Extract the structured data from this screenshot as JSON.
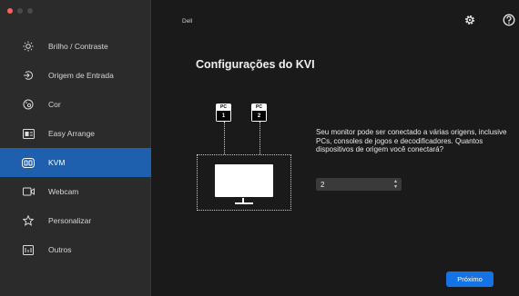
{
  "window": {
    "title": "Dell",
    "traffic_colors": [
      "#ff5f57",
      "#4a4a4a",
      "#4a4a4a"
    ]
  },
  "toolbar": {
    "settings_icon": "gear-icon",
    "help_icon": "help-icon"
  },
  "sidebar": {
    "items": [
      {
        "label": "Brilho / Contraste",
        "icon": "brightness-icon",
        "active": false
      },
      {
        "label": "Origem de Entrada",
        "icon": "input-source-icon",
        "active": false
      },
      {
        "label": "Cor",
        "icon": "color-icon",
        "active": false
      },
      {
        "label": "Easy Arrange",
        "icon": "easy-arrange-icon",
        "active": false
      },
      {
        "label": "KVM",
        "icon": "kvm-icon",
        "active": true
      },
      {
        "label": "Webcam",
        "icon": "webcam-icon",
        "active": false
      },
      {
        "label": "Personalizar",
        "icon": "star-icon",
        "active": false
      },
      {
        "label": "Outros",
        "icon": "other-icon",
        "active": false
      }
    ],
    "active_color": "#1e5fae"
  },
  "main": {
    "title": "Configurações do KVI",
    "diagram": {
      "pcs": [
        {
          "tag": "PC",
          "number": "1"
        },
        {
          "tag": "PC",
          "number": "2"
        }
      ]
    },
    "description": "Seu monitor pode ser conectado a várias origens, inclusive PCs, consoles de jogos e decodificadores. Quantos dispositivos de origem você conectará?",
    "device_count": {
      "value": "2"
    },
    "next_label": "Próximo",
    "accent": "#1673e6"
  }
}
